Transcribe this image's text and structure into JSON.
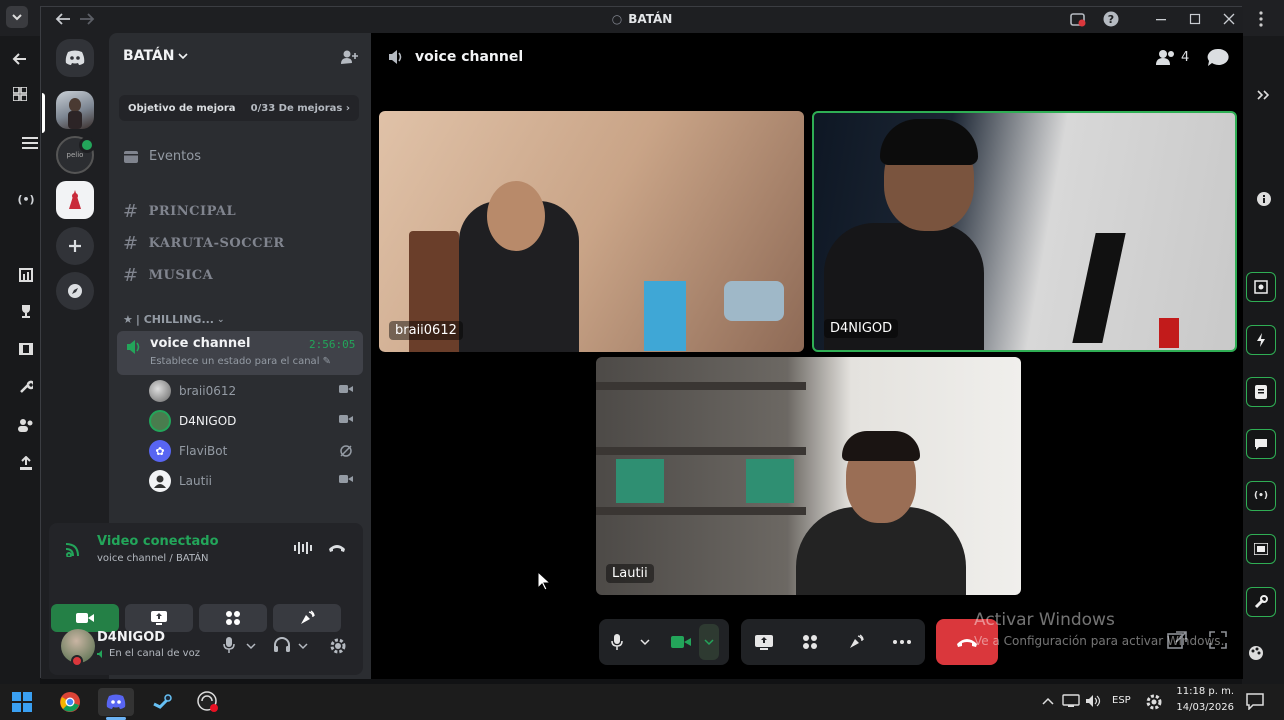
{
  "window": {
    "title": "BATÁN"
  },
  "server": {
    "name": "BATÁN",
    "boost_goal_label": "Objetivo de mejora",
    "boost_goal_progress": "0/33 De mejoras",
    "events_label": "Eventos",
    "channels": [
      "PRINCIPAL",
      "KARUTA-SOCCER",
      "MUSICA"
    ],
    "category": "| CHILLING...",
    "voice_channel": {
      "name": "voice channel",
      "timer": "2:56:05",
      "status_placeholder": "Establece un estado para el canal"
    },
    "members": [
      {
        "name": "braii0612",
        "status": "camera",
        "highlight": false
      },
      {
        "name": "D4NIGOD",
        "status": "camera",
        "highlight": true
      },
      {
        "name": "FlaviBot",
        "status": "streaming",
        "highlight": false
      },
      {
        "name": "Lautii",
        "status": "camera",
        "highlight": false
      }
    ]
  },
  "connection": {
    "title": "Video conectado",
    "subtitle": "voice channel / BATÁN"
  },
  "user": {
    "name": "D4NIGOD",
    "status": "En el canal de voz"
  },
  "stage": {
    "channel_name": "voice channel",
    "participant_count": "4",
    "tiles": [
      {
        "name": "braii0612",
        "speaking": false
      },
      {
        "name": "D4NIGOD",
        "speaking": true
      },
      {
        "name": "Lautii",
        "speaking": false
      }
    ]
  },
  "watermark": {
    "line1": "Activar Windows",
    "line2": "Ve a Configuración para activar Windows."
  },
  "taskbar": {
    "language": "ESP",
    "time": "11:18 p. m.",
    "date": "14/03/2026"
  },
  "colors": {
    "accent_green": "#23a55a",
    "danger_red": "#da373c",
    "speaking_border": "#2fae54"
  }
}
